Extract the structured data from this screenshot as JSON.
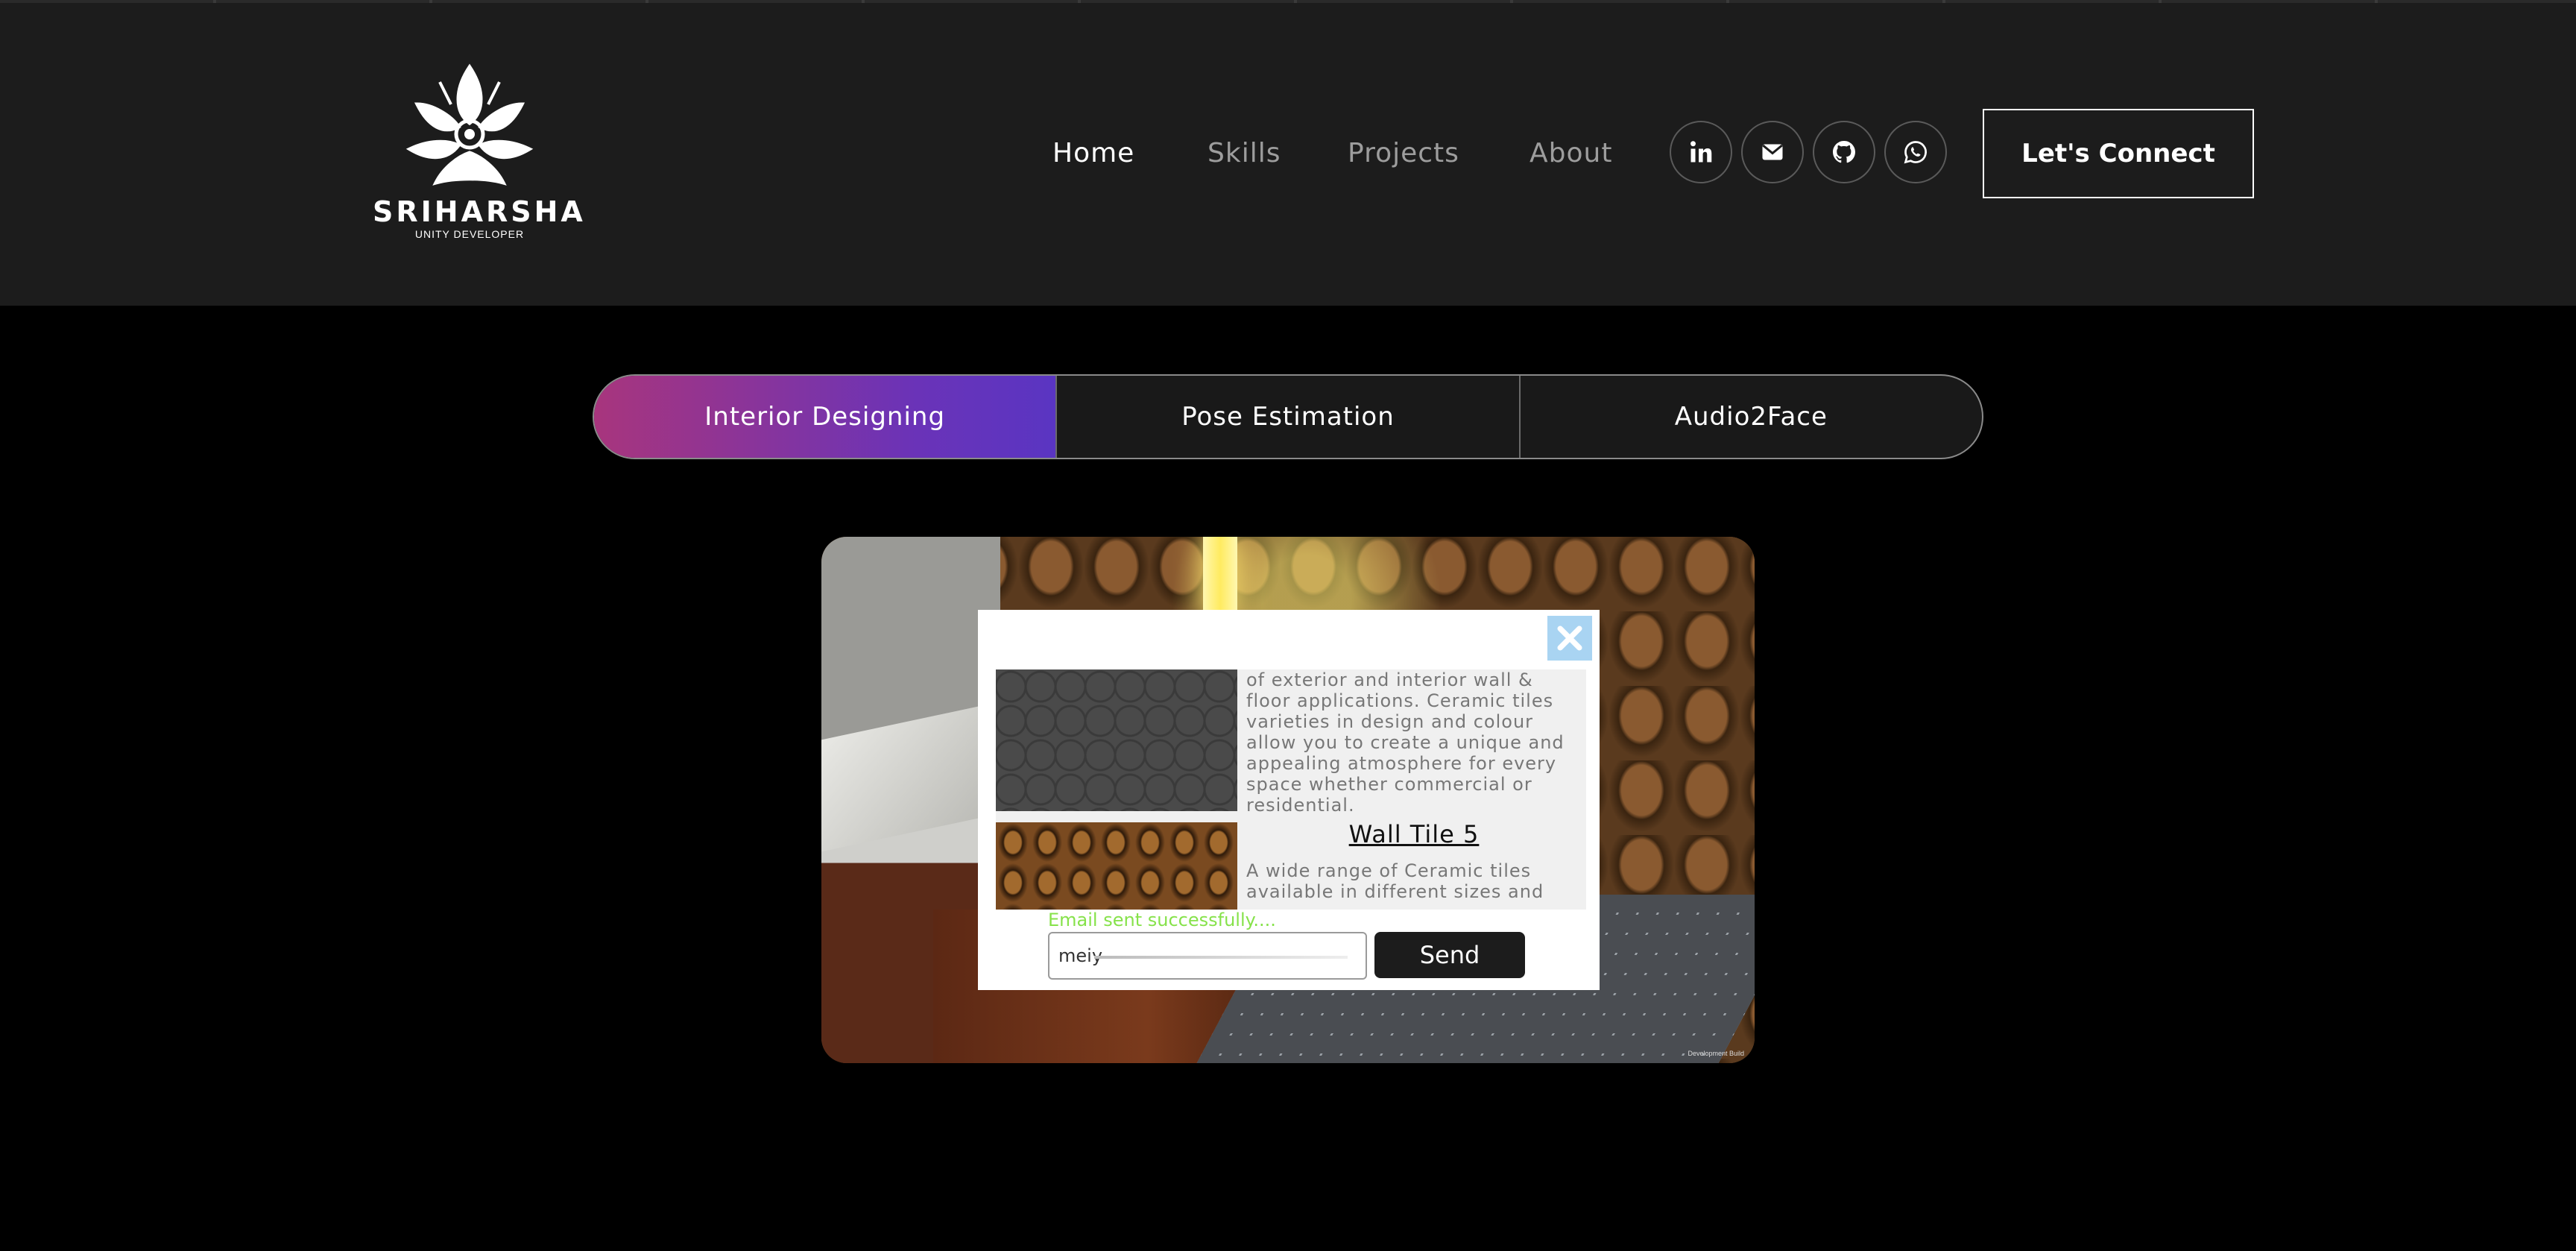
{
  "brand": {
    "name": "SRIHARSHA",
    "tagline": "UNITY DEVELOPER"
  },
  "nav": {
    "items": [
      {
        "label": "Home",
        "active": true
      },
      {
        "label": "Skills",
        "active": false
      },
      {
        "label": "Projects",
        "active": false
      },
      {
        "label": "About",
        "active": false
      }
    ]
  },
  "social": [
    {
      "icon": "linkedin-icon"
    },
    {
      "icon": "mail-icon"
    },
    {
      "icon": "github-icon"
    },
    {
      "icon": "whatsapp-icon"
    }
  ],
  "connect_label": "Let's Connect",
  "project_tabs": [
    {
      "label": "Interior Designing",
      "active": true
    },
    {
      "label": "Pose Estimation",
      "active": false
    },
    {
      "label": "Audio2Face",
      "active": false
    }
  ],
  "viewer": {
    "watermark": "Development Build",
    "dialog": {
      "tile1_desc": "of exterior and interior wall & floor applications. Ceramic tiles varieties in design and colour allow you to create a unique and appealing atmosphere for every space whether commercial or residential.",
      "tile2_title": "Wall Tile 5",
      "tile2_desc": "A wide range of Ceramic tiles available in different sizes and",
      "status": "Email sent successfully....",
      "email_value": "meiy",
      "send_label": "Send"
    }
  },
  "colors": {
    "topbar": "#1c1c1c",
    "tab_gradient_start": "#a8357d",
    "tab_gradient_end": "#5a35c2",
    "status_green": "#86e24a",
    "close_bg": "#a9d4f2"
  }
}
